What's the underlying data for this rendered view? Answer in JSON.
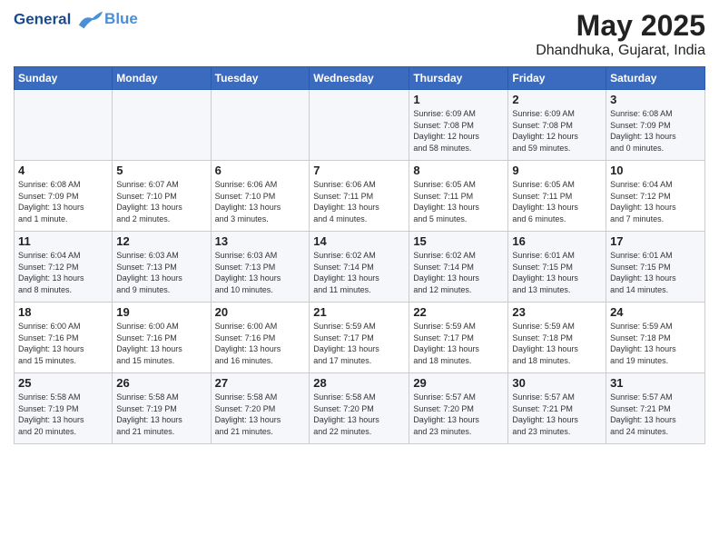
{
  "logo": {
    "line1": "General",
    "line2": "Blue"
  },
  "title": "May 2025",
  "subtitle": "Dhandhuka, Gujarat, India",
  "weekdays": [
    "Sunday",
    "Monday",
    "Tuesday",
    "Wednesday",
    "Thursday",
    "Friday",
    "Saturday"
  ],
  "weeks": [
    [
      {
        "day": "",
        "detail": ""
      },
      {
        "day": "",
        "detail": ""
      },
      {
        "day": "",
        "detail": ""
      },
      {
        "day": "",
        "detail": ""
      },
      {
        "day": "1",
        "detail": "Sunrise: 6:09 AM\nSunset: 7:08 PM\nDaylight: 12 hours\nand 58 minutes."
      },
      {
        "day": "2",
        "detail": "Sunrise: 6:09 AM\nSunset: 7:08 PM\nDaylight: 12 hours\nand 59 minutes."
      },
      {
        "day": "3",
        "detail": "Sunrise: 6:08 AM\nSunset: 7:09 PM\nDaylight: 13 hours\nand 0 minutes."
      }
    ],
    [
      {
        "day": "4",
        "detail": "Sunrise: 6:08 AM\nSunset: 7:09 PM\nDaylight: 13 hours\nand 1 minute."
      },
      {
        "day": "5",
        "detail": "Sunrise: 6:07 AM\nSunset: 7:10 PM\nDaylight: 13 hours\nand 2 minutes."
      },
      {
        "day": "6",
        "detail": "Sunrise: 6:06 AM\nSunset: 7:10 PM\nDaylight: 13 hours\nand 3 minutes."
      },
      {
        "day": "7",
        "detail": "Sunrise: 6:06 AM\nSunset: 7:11 PM\nDaylight: 13 hours\nand 4 minutes."
      },
      {
        "day": "8",
        "detail": "Sunrise: 6:05 AM\nSunset: 7:11 PM\nDaylight: 13 hours\nand 5 minutes."
      },
      {
        "day": "9",
        "detail": "Sunrise: 6:05 AM\nSunset: 7:11 PM\nDaylight: 13 hours\nand 6 minutes."
      },
      {
        "day": "10",
        "detail": "Sunrise: 6:04 AM\nSunset: 7:12 PM\nDaylight: 13 hours\nand 7 minutes."
      }
    ],
    [
      {
        "day": "11",
        "detail": "Sunrise: 6:04 AM\nSunset: 7:12 PM\nDaylight: 13 hours\nand 8 minutes."
      },
      {
        "day": "12",
        "detail": "Sunrise: 6:03 AM\nSunset: 7:13 PM\nDaylight: 13 hours\nand 9 minutes."
      },
      {
        "day": "13",
        "detail": "Sunrise: 6:03 AM\nSunset: 7:13 PM\nDaylight: 13 hours\nand 10 minutes."
      },
      {
        "day": "14",
        "detail": "Sunrise: 6:02 AM\nSunset: 7:14 PM\nDaylight: 13 hours\nand 11 minutes."
      },
      {
        "day": "15",
        "detail": "Sunrise: 6:02 AM\nSunset: 7:14 PM\nDaylight: 13 hours\nand 12 minutes."
      },
      {
        "day": "16",
        "detail": "Sunrise: 6:01 AM\nSunset: 7:15 PM\nDaylight: 13 hours\nand 13 minutes."
      },
      {
        "day": "17",
        "detail": "Sunrise: 6:01 AM\nSunset: 7:15 PM\nDaylight: 13 hours\nand 14 minutes."
      }
    ],
    [
      {
        "day": "18",
        "detail": "Sunrise: 6:00 AM\nSunset: 7:16 PM\nDaylight: 13 hours\nand 15 minutes."
      },
      {
        "day": "19",
        "detail": "Sunrise: 6:00 AM\nSunset: 7:16 PM\nDaylight: 13 hours\nand 15 minutes."
      },
      {
        "day": "20",
        "detail": "Sunrise: 6:00 AM\nSunset: 7:16 PM\nDaylight: 13 hours\nand 16 minutes."
      },
      {
        "day": "21",
        "detail": "Sunrise: 5:59 AM\nSunset: 7:17 PM\nDaylight: 13 hours\nand 17 minutes."
      },
      {
        "day": "22",
        "detail": "Sunrise: 5:59 AM\nSunset: 7:17 PM\nDaylight: 13 hours\nand 18 minutes."
      },
      {
        "day": "23",
        "detail": "Sunrise: 5:59 AM\nSunset: 7:18 PM\nDaylight: 13 hours\nand 18 minutes."
      },
      {
        "day": "24",
        "detail": "Sunrise: 5:59 AM\nSunset: 7:18 PM\nDaylight: 13 hours\nand 19 minutes."
      }
    ],
    [
      {
        "day": "25",
        "detail": "Sunrise: 5:58 AM\nSunset: 7:19 PM\nDaylight: 13 hours\nand 20 minutes."
      },
      {
        "day": "26",
        "detail": "Sunrise: 5:58 AM\nSunset: 7:19 PM\nDaylight: 13 hours\nand 21 minutes."
      },
      {
        "day": "27",
        "detail": "Sunrise: 5:58 AM\nSunset: 7:20 PM\nDaylight: 13 hours\nand 21 minutes."
      },
      {
        "day": "28",
        "detail": "Sunrise: 5:58 AM\nSunset: 7:20 PM\nDaylight: 13 hours\nand 22 minutes."
      },
      {
        "day": "29",
        "detail": "Sunrise: 5:57 AM\nSunset: 7:20 PM\nDaylight: 13 hours\nand 23 minutes."
      },
      {
        "day": "30",
        "detail": "Sunrise: 5:57 AM\nSunset: 7:21 PM\nDaylight: 13 hours\nand 23 minutes."
      },
      {
        "day": "31",
        "detail": "Sunrise: 5:57 AM\nSunset: 7:21 PM\nDaylight: 13 hours\nand 24 minutes."
      }
    ]
  ]
}
